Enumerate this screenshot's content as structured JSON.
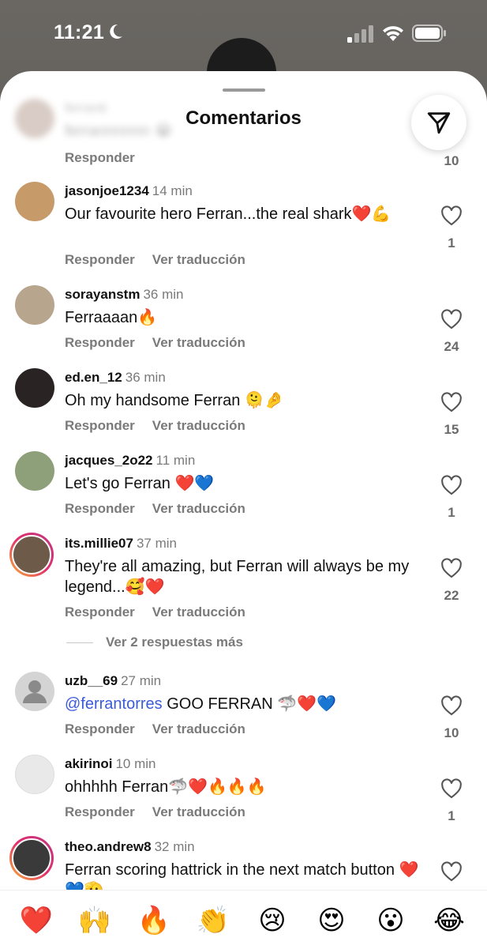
{
  "status_bar": {
    "time": "11:21"
  },
  "sheet": {
    "title": "Comentarios"
  },
  "labels": {
    "reply": "Responder",
    "translate": "Ver traducción"
  },
  "partial_comment": {
    "user": "ferranti",
    "text": "ferrannnnnn 😭",
    "likes": "10"
  },
  "comments": [
    {
      "user": "jasonjoe1234",
      "time": "14 min",
      "text": "Our favourite hero Ferran...the real shark❤️💪",
      "likes": "1",
      "avatar_color": "#c79a6a"
    },
    {
      "user": "sorayanstm",
      "time": "36 min",
      "text": "Ferraaaan🔥",
      "likes": "24",
      "avatar_color": "#b7a58e"
    },
    {
      "user": "ed.en_12",
      "time": "36 min",
      "text": "Oh my handsome Ferran 🫠🤌",
      "likes": "15",
      "avatar_color": "#2a2324"
    },
    {
      "user": "jacques_2o22",
      "time": "11 min",
      "text": "Let's go Ferran ❤️💙",
      "likes": "1",
      "avatar_color": "#8ea07a"
    },
    {
      "user": "its.millie07",
      "time": "37 min",
      "text": "They're all amazing, but Ferran will always be my legend...🥰❤️",
      "likes": "22",
      "avatar_color": "#6e5a48",
      "more_replies": "Ver 2 respuestas más"
    },
    {
      "user": "uzb__69",
      "time": "27 min",
      "mention": "@ferrantorres",
      "text": " GOO FERRAN 🦈❤️💙",
      "likes": "10",
      "avatar_color": "#d4d4d4"
    },
    {
      "user": "akirinoi",
      "time": "10 min",
      "text": "ohhhhh Ferran🦈❤️🔥🔥🔥",
      "likes": "1",
      "avatar_color": "#e9e9e9"
    },
    {
      "user": "theo.andrew8",
      "time": "32 min",
      "text": "Ferran scoring hattrick in the next match button ❤️💙🫡",
      "likes": "",
      "avatar_color": "#3a3a3a"
    }
  ],
  "emoji_bar": [
    "❤️",
    "🙌",
    "🔥",
    "👏",
    "😢",
    "😍",
    "😮",
    "😂"
  ]
}
